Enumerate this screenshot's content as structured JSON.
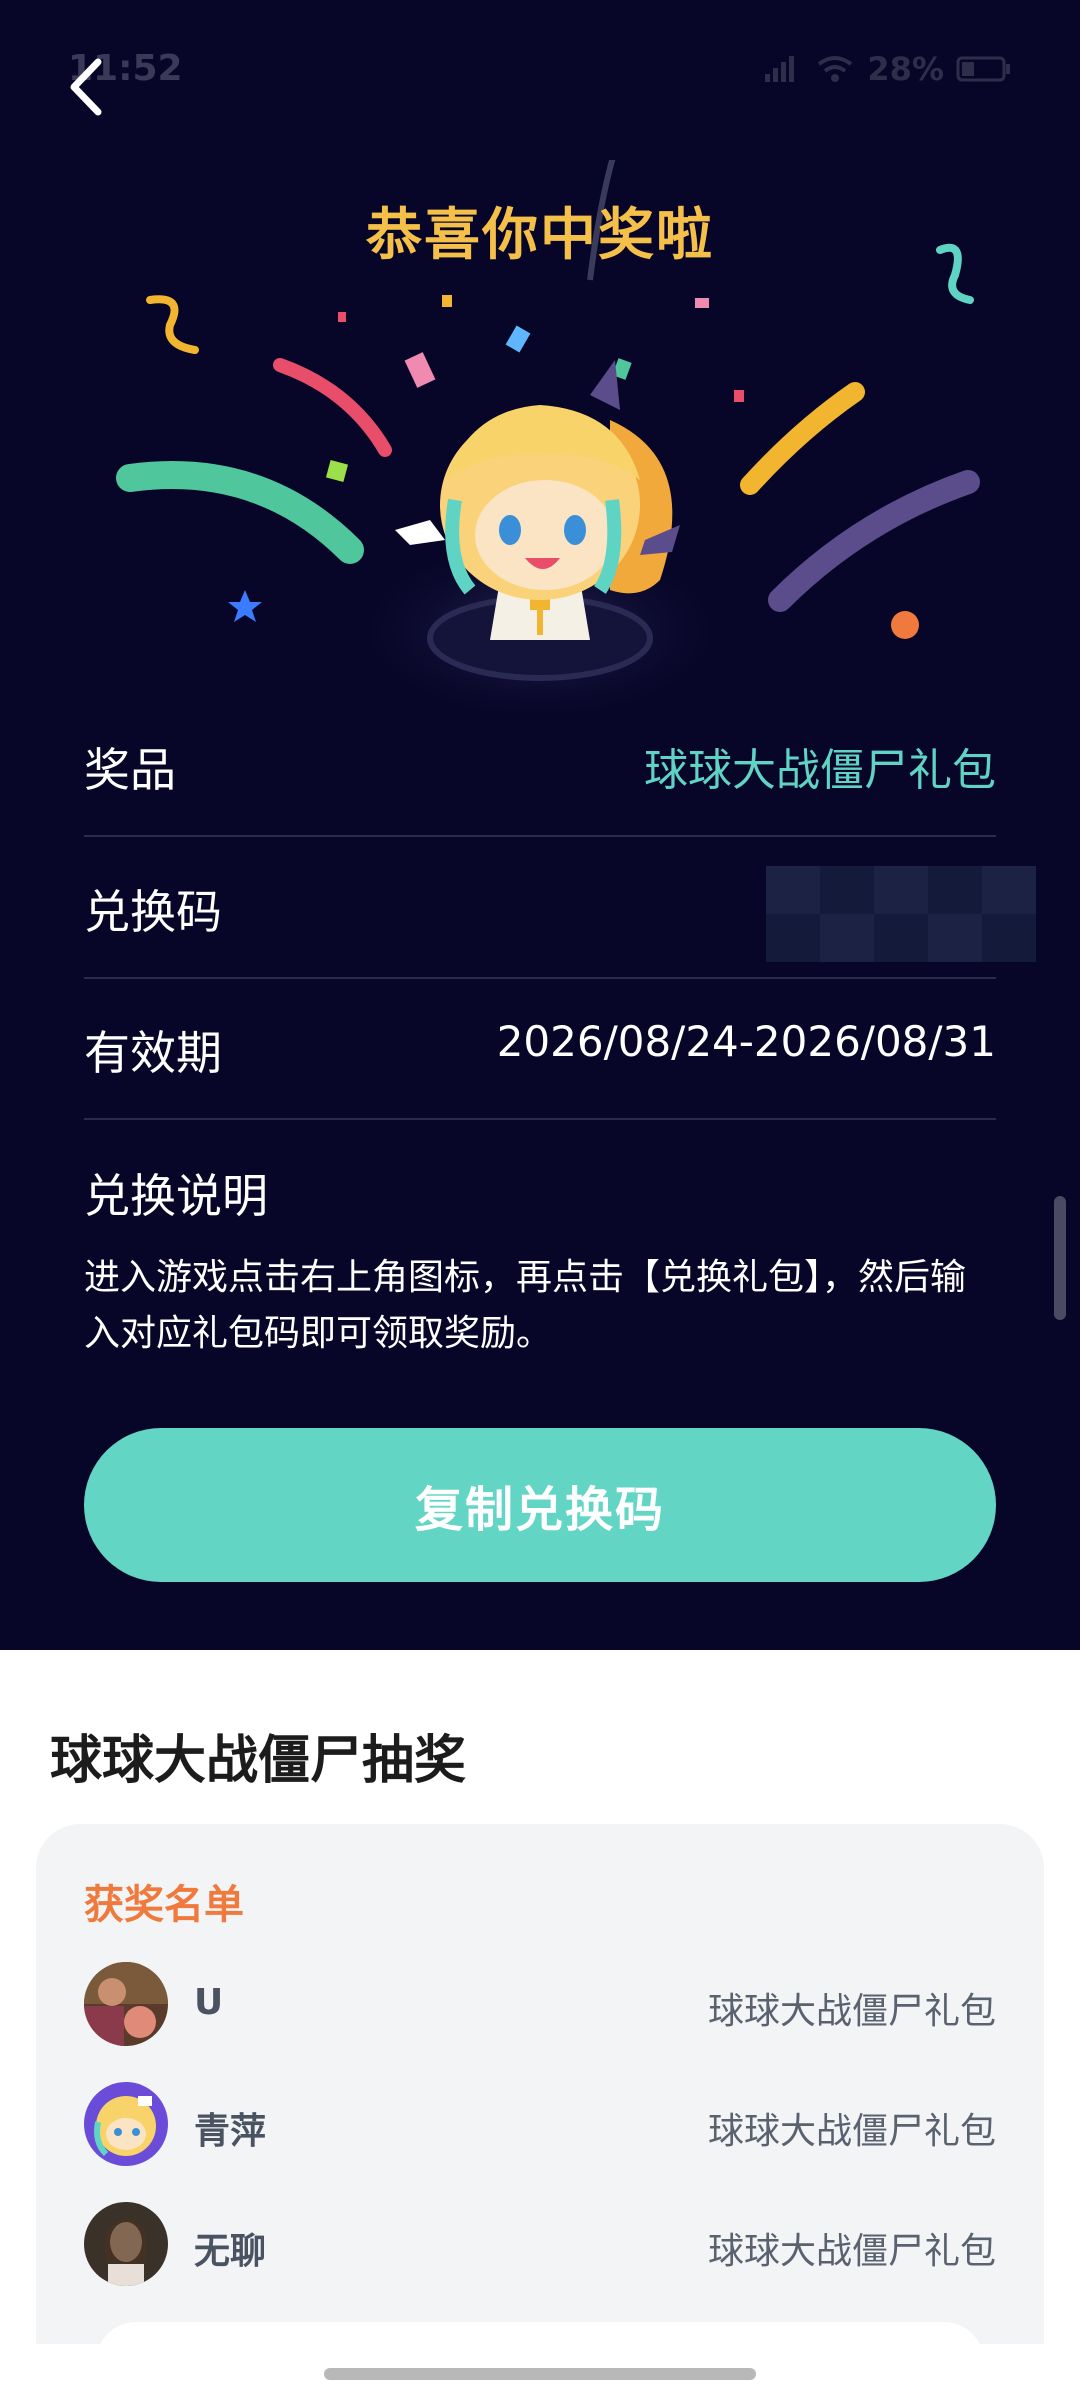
{
  "status": {
    "time": "11:52",
    "battery": "28%"
  },
  "header": {
    "congrats": "恭喜你中奖啦"
  },
  "info": {
    "prize_label": "奖品",
    "prize_value": "球球大战僵尸礼包",
    "code_label": "兑换码",
    "validity_label": "有效期",
    "validity_value": "2026/08/24-2026/08/31",
    "instructions_title": "兑换说明",
    "instructions_text": "进入游戏点击右上角图标，再点击【兑换礼包】，然后输入对应礼包码即可领取奖励。"
  },
  "actions": {
    "copy_label": "复制兑换码"
  },
  "section": {
    "title": "球球大战僵尸抽奖",
    "winners_title": "获奖名单",
    "winners": [
      {
        "name": "U",
        "prize": "球球大战僵尸礼包"
      },
      {
        "name": "青萍",
        "prize": "球球大战僵尸礼包"
      },
      {
        "name": "无聊",
        "prize": "球球大战僵尸礼包"
      }
    ]
  },
  "colors": {
    "background_dark": "#080628",
    "accent_teal": "#62d5c4",
    "title_gold": "#f5c04a",
    "winners_orange": "#f07a3e"
  }
}
